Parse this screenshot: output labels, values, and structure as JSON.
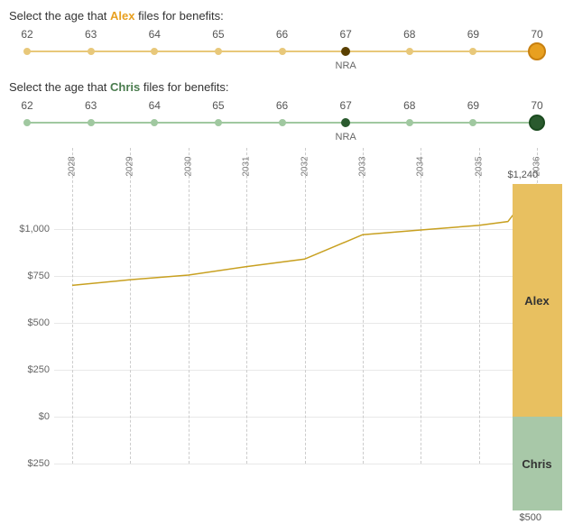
{
  "alex_label": "Select the age that ",
  "alex_name": "Alex",
  "alex_label_suffix": " files for benefits:",
  "chris_label": "Select the age that ",
  "chris_name": "Chris",
  "chris_label_suffix": " files for benefits:",
  "ages": [
    "62",
    "63",
    "64",
    "65",
    "66",
    "67",
    "68",
    "69",
    "70"
  ],
  "alex_selected_age": "70",
  "chris_selected_age": "70",
  "nra_label": "NRA",
  "nra_age_alex": "67",
  "nra_age_chris": "67",
  "years": [
    "2028",
    "2029",
    "2030",
    "2031",
    "2032",
    "2033",
    "2034",
    "2035",
    "2036"
  ],
  "y_labels": [
    "$1,000",
    "$750",
    "$500",
    "$250",
    "$0",
    "$250"
  ],
  "chart": {
    "bar_alex_label": "Alex",
    "bar_chris_label": "Chris",
    "price_top": "$1,240",
    "price_bottom": "$500"
  },
  "colors": {
    "alex_track": "#e8c87a",
    "alex_thumb": "#e8a020",
    "alex_nra": "#5a4000",
    "chris_track": "#a0c8a0",
    "chris_thumb": "#2a5a2e",
    "chris_nra": "#2a5a2e",
    "bar_alex": "#e8c060",
    "bar_chris": "#a8c8a8"
  }
}
